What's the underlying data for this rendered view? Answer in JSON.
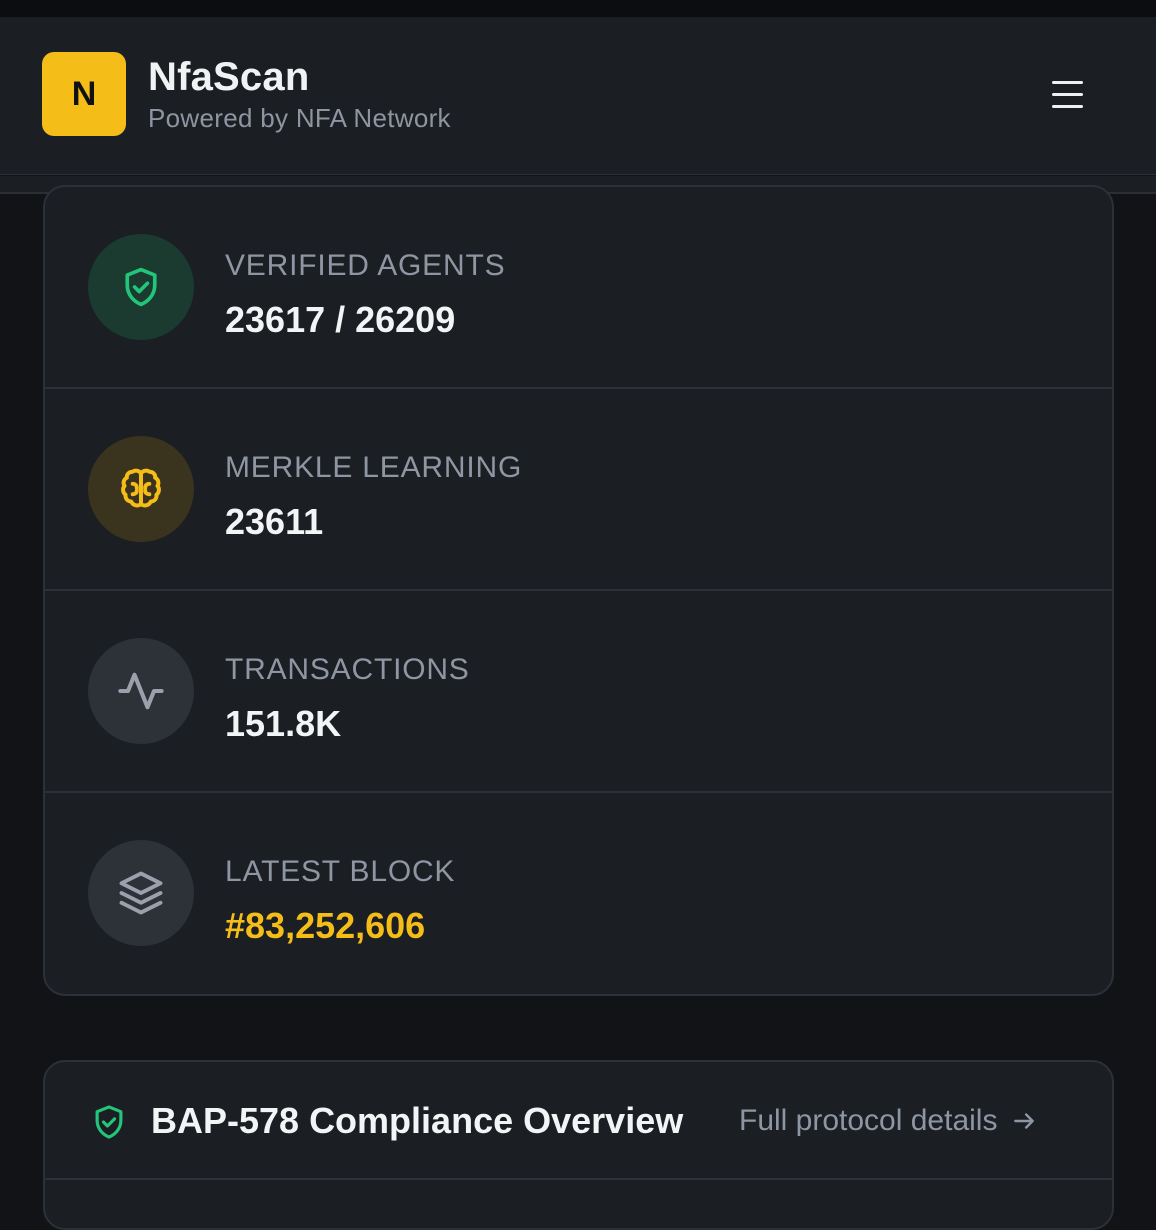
{
  "brand": {
    "logo_letter": "N",
    "name": "NfaScan",
    "tagline": "Powered by NFA Network"
  },
  "stats": [
    {
      "label": "VERIFIED AGENTS",
      "value": "23617 / 26209",
      "icon": "shield-check-icon",
      "icon_color": "#22c57a",
      "icon_bg": "#1b3a30"
    },
    {
      "label": "MERKLE LEARNING",
      "value": "23611",
      "icon": "brain-icon",
      "icon_color": "#f5bd18",
      "icon_bg": "#3a331e"
    },
    {
      "label": "TRANSACTIONS",
      "value": "151.8K",
      "icon": "activity-icon",
      "icon_color": "#9aa1ad",
      "icon_bg": "#2d3138"
    },
    {
      "label": "LATEST BLOCK",
      "value": "#83,252,606",
      "icon": "layers-icon",
      "icon_color": "#9aa1ad",
      "icon_bg": "#2d3138",
      "value_color": "#f5bd18"
    }
  ],
  "compliance": {
    "title": "BAP-578 Compliance Overview",
    "link": "Full protocol details",
    "icon": "shield-check-icon"
  },
  "colors": {
    "background": "#111317",
    "surface": "#1b1e23",
    "border": "#2c3038",
    "accent": "#f5bd18",
    "success": "#22c57a"
  }
}
